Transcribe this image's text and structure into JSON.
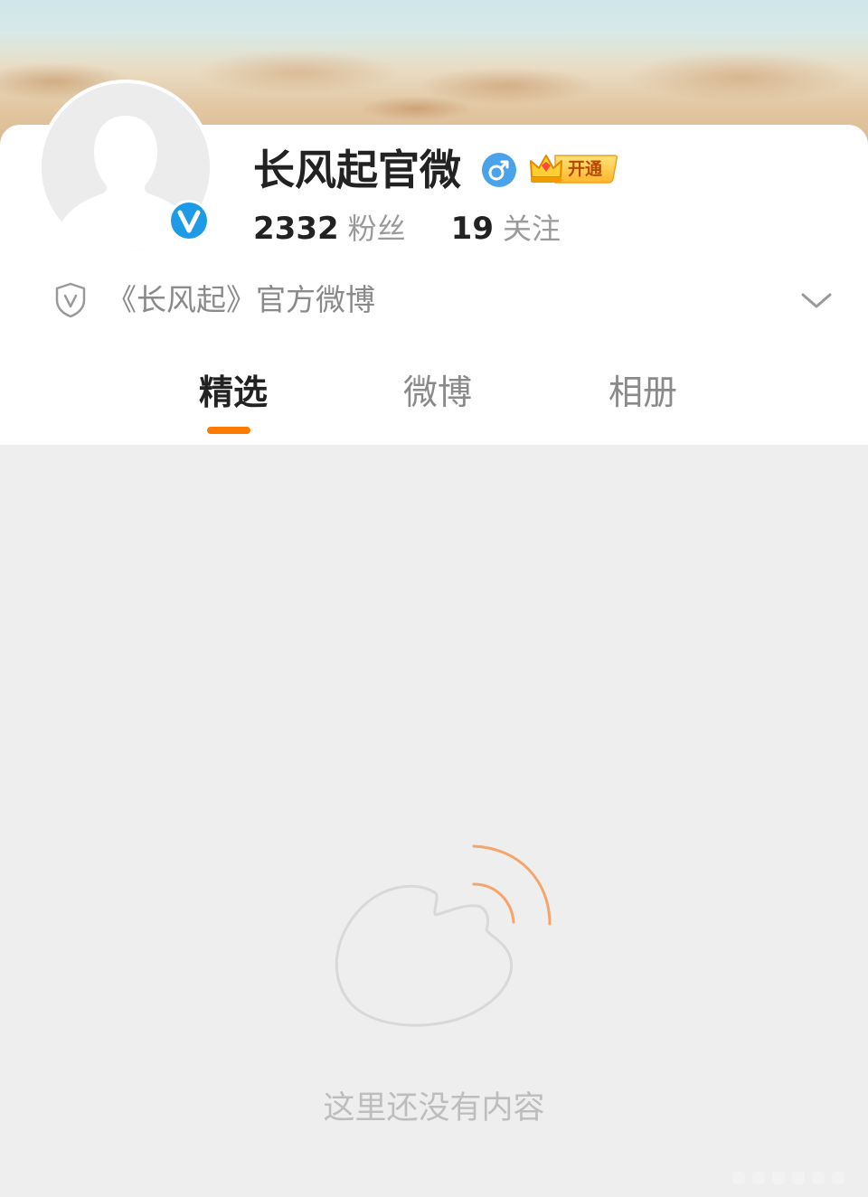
{
  "profile": {
    "name": "长风起官微",
    "gender_icon": "male-icon",
    "vip_label": "开通",
    "verified_icon": "verified-v-icon",
    "stats": {
      "fans_count": "2332",
      "fans_label": "粉丝",
      "following_count": "19",
      "following_label": "关注"
    },
    "description": "《长风起》官方微博"
  },
  "tabs": [
    {
      "label": "精选",
      "active": true
    },
    {
      "label": "微博",
      "active": false
    },
    {
      "label": "相册",
      "active": false
    }
  ],
  "empty_state": {
    "message": "这里还没有内容",
    "icon": "weibo-logo-icon"
  },
  "colors": {
    "accent": "#ff7a00",
    "verified_blue": "#1e9be6",
    "gender_blue": "#4aa3e8",
    "vip_gold": "#ffc53d"
  }
}
